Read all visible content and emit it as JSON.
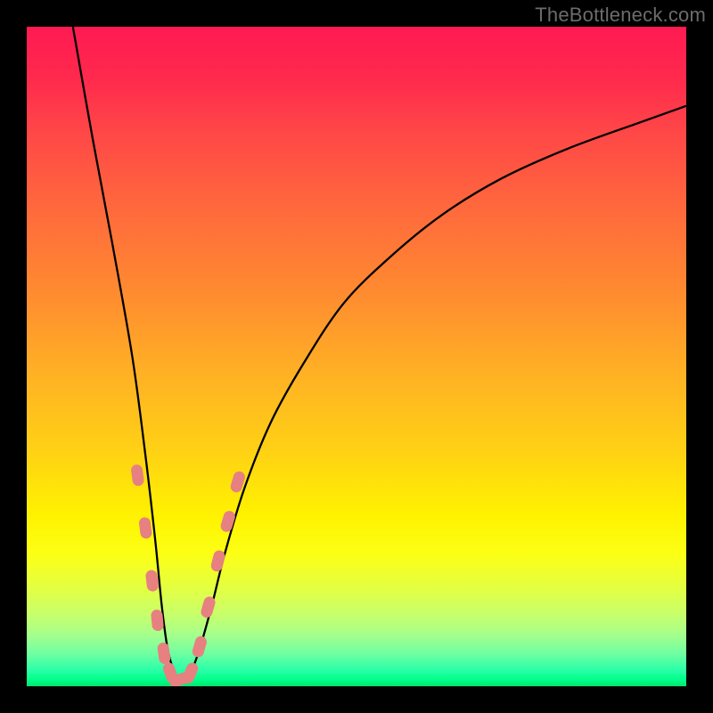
{
  "watermark": "TheBottleneck.com",
  "chart_data": {
    "type": "line",
    "title": "",
    "xlabel": "",
    "ylabel": "",
    "xlim": [
      0,
      100
    ],
    "ylim": [
      0,
      100
    ],
    "series": [
      {
        "name": "bottleneck-curve",
        "x": [
          7,
          10,
          13,
          16,
          18,
          19.5,
          20.5,
          21.5,
          23,
          24.5,
          26,
          28,
          30,
          33,
          37,
          42,
          48,
          55,
          63,
          72,
          82,
          93,
          100
        ],
        "values": [
          100,
          83,
          67,
          50,
          35,
          22,
          12,
          5,
          1,
          1.5,
          5,
          12,
          20,
          30,
          40,
          49,
          58,
          65,
          71.5,
          77,
          81.5,
          85.5,
          88
        ],
        "color": "#000000"
      }
    ],
    "markers": {
      "name": "highlight-dots",
      "color": "#e78080",
      "style": "capsule",
      "points": [
        {
          "x": 16.8,
          "y": 32
        },
        {
          "x": 18.0,
          "y": 24
        },
        {
          "x": 19.0,
          "y": 16
        },
        {
          "x": 19.8,
          "y": 10
        },
        {
          "x": 20.8,
          "y": 5
        },
        {
          "x": 21.8,
          "y": 2
        },
        {
          "x": 23.2,
          "y": 1
        },
        {
          "x": 24.8,
          "y": 2
        },
        {
          "x": 26.2,
          "y": 6
        },
        {
          "x": 27.5,
          "y": 12
        },
        {
          "x": 29.0,
          "y": 19
        },
        {
          "x": 30.5,
          "y": 25
        },
        {
          "x": 32.0,
          "y": 31
        }
      ]
    },
    "background": {
      "type": "vertical-gradient",
      "description": "red(top) to yellow to green(bottom)"
    }
  }
}
